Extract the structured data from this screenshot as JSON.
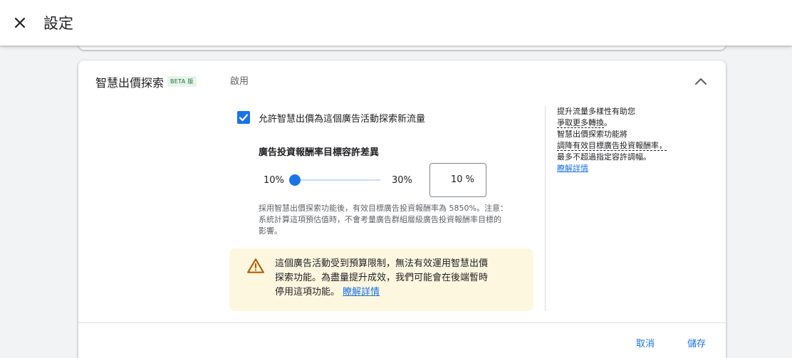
{
  "header": {
    "title": "設定",
    "close_icon": "close-icon"
  },
  "section": {
    "title": "智慧出價探索",
    "badge": "BETA 版",
    "summary": "啟用",
    "expand_icon": "chevron-up-icon"
  },
  "checkbox": {
    "label": "允許智慧出價為這個廣告活動探索新流量",
    "checked": true
  },
  "slider": {
    "title": "廣告投資報酬率目標容許差異",
    "min_label": "10%",
    "max_label": "30%",
    "input_value": "10",
    "input_suffix": "%"
  },
  "note": {
    "line1": "採用智慧出價探索功能後，有效目標廣告投資報酬率為 5850%。注意：",
    "line2": "系統計算這項預估值時，不會考量廣告群組層級廣告投資報酬率目標的",
    "line3": "影響。"
  },
  "warning": {
    "line1": "這個廣告活動受到預算限制，無法有效運用智慧出價",
    "line2": "探索功能。為盡量提升成效，我們可能會在後端暫時",
    "line3": "停用這項功能。",
    "link": "瞭解詳情",
    "icon": "warning-icon"
  },
  "sidebar": {
    "line1": "提升流量多樣性有助您",
    "line2": "爭取更多轉換",
    "line2_end": "。",
    "line3": "智慧出價探索功能將",
    "line4": "調降有效目標廣告投資報酬率，",
    "line5": "最多不超過指定容許調幅。",
    "link": "瞭解詳情"
  },
  "actions": {
    "cancel": "取消",
    "save": "儲存"
  },
  "colors": {
    "accent": "#1a73e8",
    "warning_bg": "#fef7e0",
    "warning_icon": "#b06000",
    "beta_bg": "#e6f4ea"
  }
}
